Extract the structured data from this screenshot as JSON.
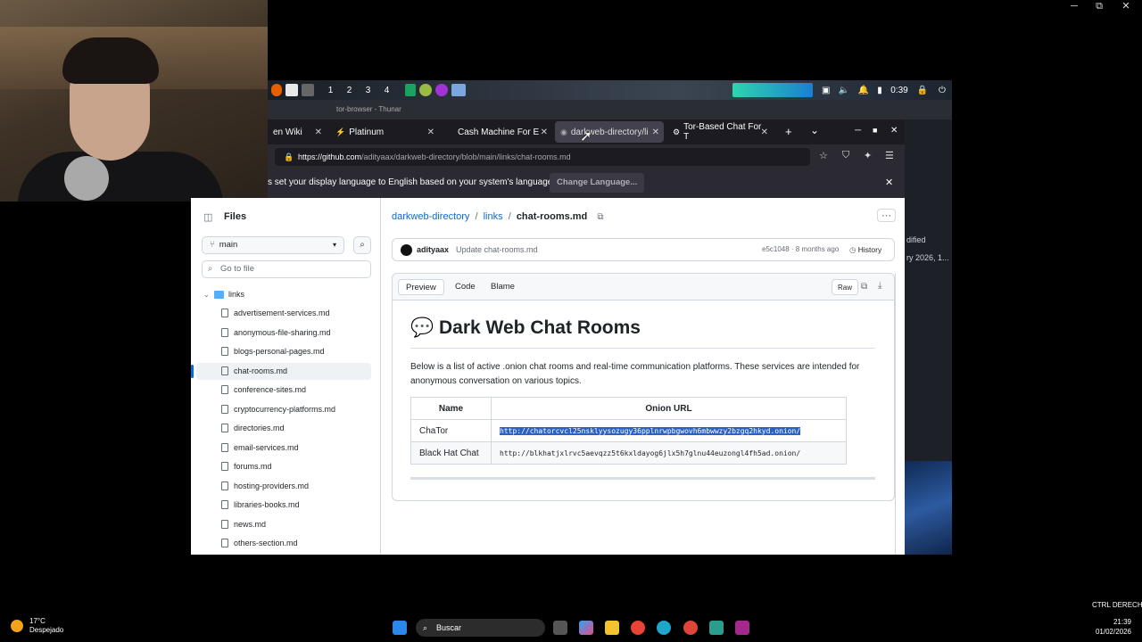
{
  "webcam": {
    "label": "webcam overlay"
  },
  "window_controls": {
    "minimize": "─",
    "maximize": "⧉",
    "close": "✕"
  },
  "xfce_panel": {
    "workspaces": [
      "1",
      "2",
      "3",
      "4"
    ],
    "clock": "0:39"
  },
  "thunar_title": "tor-browser - Thunar",
  "right_window": {
    "line1": "dified",
    "line2": "ry 2026, 1..."
  },
  "browser": {
    "tabs": [
      {
        "label": "en Wiki",
        "close": "✕"
      },
      {
        "label": "Platinum",
        "close": "✕"
      },
      {
        "label": "Cash Machine For E",
        "close": "✕"
      },
      {
        "label": "darkweb-directory/li",
        "close": "✕"
      },
      {
        "label": "Tor-Based Chat For T",
        "close": "✕"
      }
    ],
    "new_tab": "+",
    "tab_list": "⌄",
    "url_host": "https://github.com",
    "url_path": "/adityaax/darkweb-directory/blob/main/links/chat-rooms.md",
    "notification": "s set your display language to English based on your system's language.",
    "change_language": "Change Language...",
    "close_notif": "✕"
  },
  "github": {
    "files_title": "Files",
    "branch": "main",
    "go_to_file_placeholder": "Go to file",
    "folder": "links",
    "files": [
      "advertisement-services.md",
      "anonymous-file-sharing.md",
      "blogs-personal-pages.md",
      "chat-rooms.md",
      "conference-sites.md",
      "cryptocurrency-platforms.md",
      "directories.md",
      "email-services.md",
      "forums.md",
      "hosting-providers.md",
      "libraries-books.md",
      "news.md",
      "others-section.md"
    ],
    "selected_file_index": 3,
    "breadcrumb": {
      "repo": "darkweb-directory",
      "sep": "/",
      "dir": "links",
      "file": "chat-rooms.md"
    },
    "commit": {
      "author": "adityaax",
      "message": "Update chat-rooms.md",
      "meta": "e5c1048 · 8 months ago",
      "history": "History"
    },
    "view_tabs": [
      "Preview",
      "Code",
      "Blame"
    ],
    "raw": "Raw",
    "heading": "Dark Web Chat Rooms",
    "heading_emoji": "💬",
    "intro": "Below is a list of active .onion chat rooms and real-time communication platforms. These services are intended for anonymous conversation on various topics.",
    "table": {
      "headers": [
        "Name",
        "Onion URL"
      ],
      "rows": [
        {
          "name": "ChaTor",
          "url": "http://chatorcvcl25nsklyysozugy36pplnrwpbgwovh6mbwwzy2bzgq2hkyd.onion/"
        },
        {
          "name": "Black Hat Chat",
          "url": "http://blkhatjxlrvc5aevqzz5t6kxldayog6jlx5h7glnu44euzongl4fh5ad.onion/"
        }
      ]
    }
  },
  "taskbar": {
    "temp": "17°C",
    "condition": "Despejado",
    "search": "Buscar",
    "time": "21:39",
    "date": "01/02/2026",
    "ctrl": "CTRL DERECHA"
  }
}
